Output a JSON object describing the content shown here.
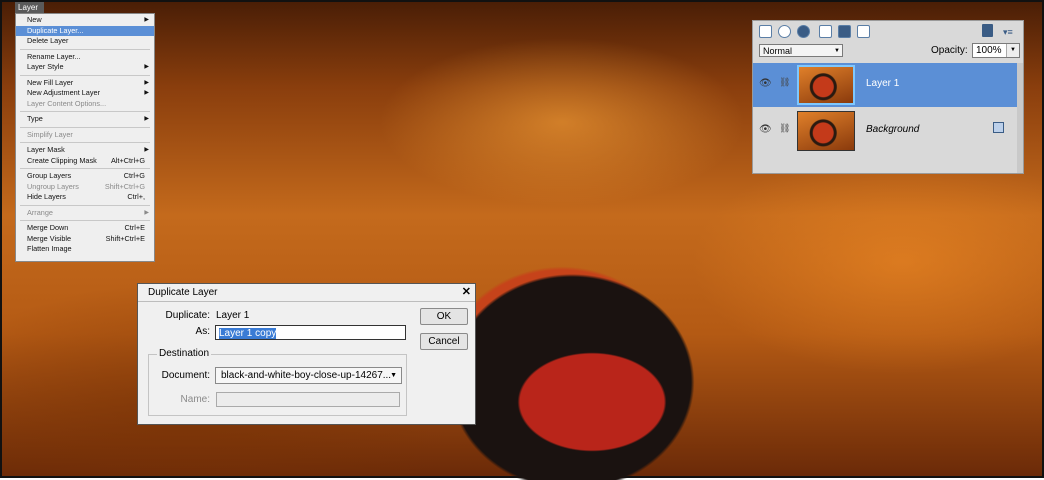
{
  "menu": {
    "title": "Layer",
    "items": [
      {
        "label": "New",
        "shortcut": "",
        "submenu": true,
        "disabled": false,
        "highlighted": false
      },
      {
        "label": "Duplicate Layer...",
        "shortcut": "",
        "submenu": false,
        "disabled": false,
        "highlighted": true
      },
      {
        "label": "Delete Layer",
        "shortcut": "",
        "submenu": false,
        "disabled": false,
        "highlighted": false
      },
      {
        "label": "Rename Layer...",
        "shortcut": "",
        "submenu": false,
        "disabled": false,
        "highlighted": false
      },
      {
        "label": "Layer Style",
        "shortcut": "",
        "submenu": true,
        "disabled": false,
        "highlighted": false
      },
      {
        "label": "New Fill Layer",
        "shortcut": "",
        "submenu": true,
        "disabled": false,
        "highlighted": false
      },
      {
        "label": "New Adjustment Layer",
        "shortcut": "",
        "submenu": true,
        "disabled": false,
        "highlighted": false
      },
      {
        "label": "Layer Content Options...",
        "shortcut": "",
        "submenu": false,
        "disabled": true,
        "highlighted": false
      },
      {
        "label": "Type",
        "shortcut": "",
        "submenu": true,
        "disabled": false,
        "highlighted": false
      },
      {
        "label": "Simplify Layer",
        "shortcut": "",
        "submenu": false,
        "disabled": true,
        "highlighted": false
      },
      {
        "label": "Layer Mask",
        "shortcut": "",
        "submenu": true,
        "disabled": false,
        "highlighted": false
      },
      {
        "label": "Create Clipping Mask",
        "shortcut": "Alt+Ctrl+G",
        "submenu": false,
        "disabled": false,
        "highlighted": false
      },
      {
        "label": "Group Layers",
        "shortcut": "Ctrl+G",
        "submenu": false,
        "disabled": false,
        "highlighted": false
      },
      {
        "label": "Ungroup Layers",
        "shortcut": "Shift+Ctrl+G",
        "submenu": false,
        "disabled": true,
        "highlighted": false
      },
      {
        "label": "Hide Layers",
        "shortcut": "Ctrl+,",
        "submenu": false,
        "disabled": false,
        "highlighted": false
      },
      {
        "label": "Arrange",
        "shortcut": "",
        "submenu": true,
        "disabled": true,
        "highlighted": false
      },
      {
        "label": "Merge Down",
        "shortcut": "Ctrl+E",
        "submenu": false,
        "disabled": false,
        "highlighted": false
      },
      {
        "label": "Merge Visible",
        "shortcut": "Shift+Ctrl+E",
        "submenu": false,
        "disabled": false,
        "highlighted": false
      },
      {
        "label": "Flatten Image",
        "shortcut": "",
        "submenu": false,
        "disabled": false,
        "highlighted": false
      }
    ]
  },
  "layers_panel": {
    "blend_mode": "Normal",
    "opacity_label": "Opacity:",
    "opacity_value": "100%",
    "toolbar_icons": [
      "new-layer-icon",
      "new-group-icon",
      "adjustment-layer-icon",
      "layer-mask-icon",
      "lock-all-icon",
      "lock-transparency-icon",
      "trash-icon",
      "panel-menu-icon"
    ],
    "layers": [
      {
        "name": "Layer 1",
        "selected": true,
        "visible": true
      },
      {
        "name": "Background",
        "selected": false,
        "visible": true,
        "locked": true
      }
    ]
  },
  "dialog": {
    "title": "Duplicate Layer",
    "duplicate_label": "Duplicate:",
    "duplicate_value": "Layer 1",
    "as_label": "As:",
    "as_value": "Layer 1 copy",
    "ok_label": "OK",
    "cancel_label": "Cancel",
    "destination_label": "Destination",
    "document_label": "Document:",
    "document_value": "black-and-white-boy-close-up-14267...",
    "name_label": "Name:",
    "name_value": ""
  },
  "colors": {
    "selection_blue": "#5b8fd6",
    "highlight_text": "#3a7bd5"
  }
}
